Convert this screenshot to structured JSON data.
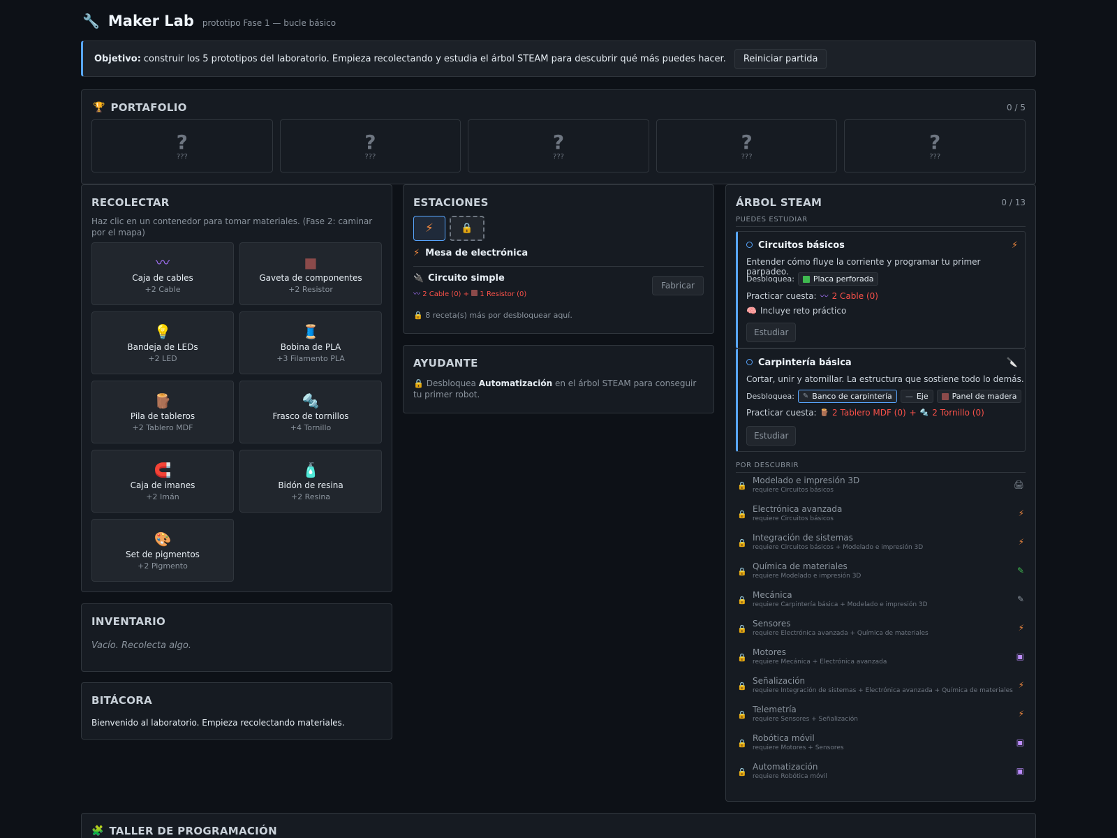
{
  "header": {
    "icon": "wrench-icon",
    "title": "Maker Lab",
    "subtitle": "prototipo Fase 1 — bucle básico"
  },
  "objective": {
    "label": "Objetivo:",
    "text": "construir los 5 prototipos del laboratorio. Empieza recolectando y estudia el árbol STEAM para descubrir qué más puedes hacer.",
    "reset_button": "Reiniciar partida"
  },
  "portfolio": {
    "icon": "trophy-icon",
    "title": "PORTAFOLIO",
    "count": "0 / 5",
    "slots": [
      {
        "mark": "?",
        "label": "???"
      },
      {
        "mark": "?",
        "label": "???"
      },
      {
        "mark": "?",
        "label": "???"
      },
      {
        "mark": "?",
        "label": "???"
      },
      {
        "mark": "?",
        "label": "???"
      }
    ]
  },
  "collect": {
    "title": "RECOLECTAR",
    "description": "Haz clic en un contenedor para tomar materiales. (Fase 2: caminar por el mapa)",
    "items": [
      {
        "icon": "cable-icon",
        "glyph": "〰",
        "color": "#a371f7",
        "name": "Caja de cables",
        "gain": "+2 Cable"
      },
      {
        "icon": "resistor-icon",
        "glyph": "■",
        "color": "#8b4a4a",
        "name": "Gaveta de componentes",
        "gain": "+2 Resistor"
      },
      {
        "icon": "bulb-icon",
        "glyph": "💡",
        "color": "#f2cc60",
        "name": "Bandeja de LEDs",
        "gain": "+2 LED"
      },
      {
        "icon": "spool-icon",
        "glyph": "🧵",
        "color": "#58a6ff",
        "name": "Bobina de PLA",
        "gain": "+3 Filamento PLA"
      },
      {
        "icon": "wood-icon",
        "glyph": "🪵",
        "color": "#a0522d",
        "name": "Pila de tableros",
        "gain": "+2 Tablero MDF"
      },
      {
        "icon": "screw-icon",
        "glyph": "🔩",
        "color": "#8b949e",
        "name": "Frasco de tornillos",
        "gain": "+4 Tornillo"
      },
      {
        "icon": "magnet-icon",
        "glyph": "🧲",
        "color": "#f85149",
        "name": "Caja de imanes",
        "gain": "+2 Imán"
      },
      {
        "icon": "resin-icon",
        "glyph": "🧴",
        "color": "#79c0ff",
        "name": "Bidón de resina",
        "gain": "+2 Resina"
      },
      {
        "icon": "palette-icon",
        "glyph": "🎨",
        "color": "#f0883e",
        "name": "Set de pigmentos",
        "gain": "+2 Pigmento"
      }
    ]
  },
  "inventory": {
    "title": "INVENTARIO",
    "empty": "Vacío. Recolecta algo."
  },
  "log": {
    "title": "BITÁCORA",
    "entry": "Bienvenido al laboratorio. Empieza recolectando materiales."
  },
  "stations": {
    "title": "ESTACIONES",
    "tabs": [
      {
        "icon": "bolt-icon",
        "glyph": "⚡"
      },
      {
        "icon": "lock-icon",
        "glyph": "🔒"
      }
    ],
    "current": {
      "icon": "bolt-icon",
      "glyph": "⚡",
      "name": "Mesa de electrónica"
    },
    "recipe": {
      "icon": "circuit-icon",
      "glyph": "🔌",
      "name": "Circuito simple",
      "cost_cable": "2 Cable (0)",
      "plus": "+",
      "cost_resistor": "1 Resistor (0)",
      "button": "Fabricar"
    },
    "more": "8 receta(s) más por desbloquear aquí."
  },
  "helper": {
    "title": "AYUDANTE",
    "pre": "Desbloquea",
    "bold": "Automatización",
    "post": "en el árbol STEAM para conseguir tu primer robot."
  },
  "tree": {
    "title": "ÁRBOL STEAM",
    "count": "0 / 13",
    "available_label": "PUEDES ESTUDIAR",
    "nodes": [
      {
        "name": "Circuitos básicos",
        "icon": "bolt-icon",
        "glyph": "⚡",
        "desc": "Entender cómo fluye la corriente y programar tu primer parpadeo.",
        "unlocks_label": "Desbloquea:",
        "unlocks": [
          {
            "name": "Placa perforada",
            "color": "#3fb950"
          }
        ],
        "cost_label": "Practicar cuesta:",
        "cost": "2 Cable (0)",
        "challenge": "Incluye reto práctico",
        "button": "Estudiar"
      },
      {
        "name": "Carpintería básica",
        "icon": "saw-icon",
        "glyph": "🔪",
        "desc": "Cortar, unir y atornillar. La estructura que sostiene todo lo demás.",
        "unlocks_label": "Desbloquea:",
        "unlocks": [
          {
            "name": "Banco de carpintería",
            "color": "#8b949e"
          },
          {
            "name": "Eje",
            "color": "#8b949e"
          },
          {
            "name": "Panel de madera",
            "color": "#8b4a4a"
          }
        ],
        "cost_label": "Practicar cuesta:",
        "cost_a": "2 Tablero MDF (0)",
        "plus": "+",
        "cost_b": "2 Tornillo (0)",
        "button": "Estudiar"
      }
    ],
    "locked_label": "POR DESCUBRIR",
    "locked": [
      {
        "name": "Modelado e impresión 3D",
        "req": "requiere Circuitos básicos",
        "icon": "printer-icon",
        "glyph": "🖨",
        "color": "#8b949e"
      },
      {
        "name": "Electrónica avanzada",
        "req": "requiere Circuitos básicos",
        "icon": "bolt-icon",
        "glyph": "⚡",
        "color": "#f0883e"
      },
      {
        "name": "Integración de sistemas",
        "req": "requiere Circuitos básicos + Modelado e impresión 3D",
        "icon": "bolt-icon",
        "glyph": "⚡",
        "color": "#f0883e"
      },
      {
        "name": "Química de materiales",
        "req": "requiere Modelado e impresión 3D",
        "icon": "brush-icon",
        "glyph": "✎",
        "color": "#3fb950"
      },
      {
        "name": "Mecánica",
        "req": "requiere Carpintería básica + Modelado e impresión 3D",
        "icon": "saw-icon",
        "glyph": "✎",
        "color": "#8b949e"
      },
      {
        "name": "Sensores",
        "req": "requiere Electrónica avanzada + Química de materiales",
        "icon": "bolt-icon",
        "glyph": "⚡",
        "color": "#f0883e"
      },
      {
        "name": "Motores",
        "req": "requiere Mecánica + Electrónica avanzada",
        "icon": "robot-icon",
        "glyph": "▣",
        "color": "#bc8cff"
      },
      {
        "name": "Señalización",
        "req": "requiere Integración de sistemas + Electrónica avanzada + Química de materiales",
        "icon": "bolt-icon",
        "glyph": "⚡",
        "color": "#f0883e"
      },
      {
        "name": "Telemetría",
        "req": "requiere Sensores + Señalización",
        "icon": "bolt-icon",
        "glyph": "⚡",
        "color": "#f0883e"
      },
      {
        "name": "Robótica móvil",
        "req": "requiere Motores + Sensores",
        "icon": "robot-icon",
        "glyph": "▣",
        "color": "#bc8cff"
      },
      {
        "name": "Automatización",
        "req": "requiere Robótica móvil",
        "icon": "robot-icon",
        "glyph": "▣",
        "color": "#bc8cff"
      }
    ]
  },
  "taller": {
    "icon": "puzzle-icon",
    "title": "TALLER DE PROGRAMACIÓN"
  }
}
